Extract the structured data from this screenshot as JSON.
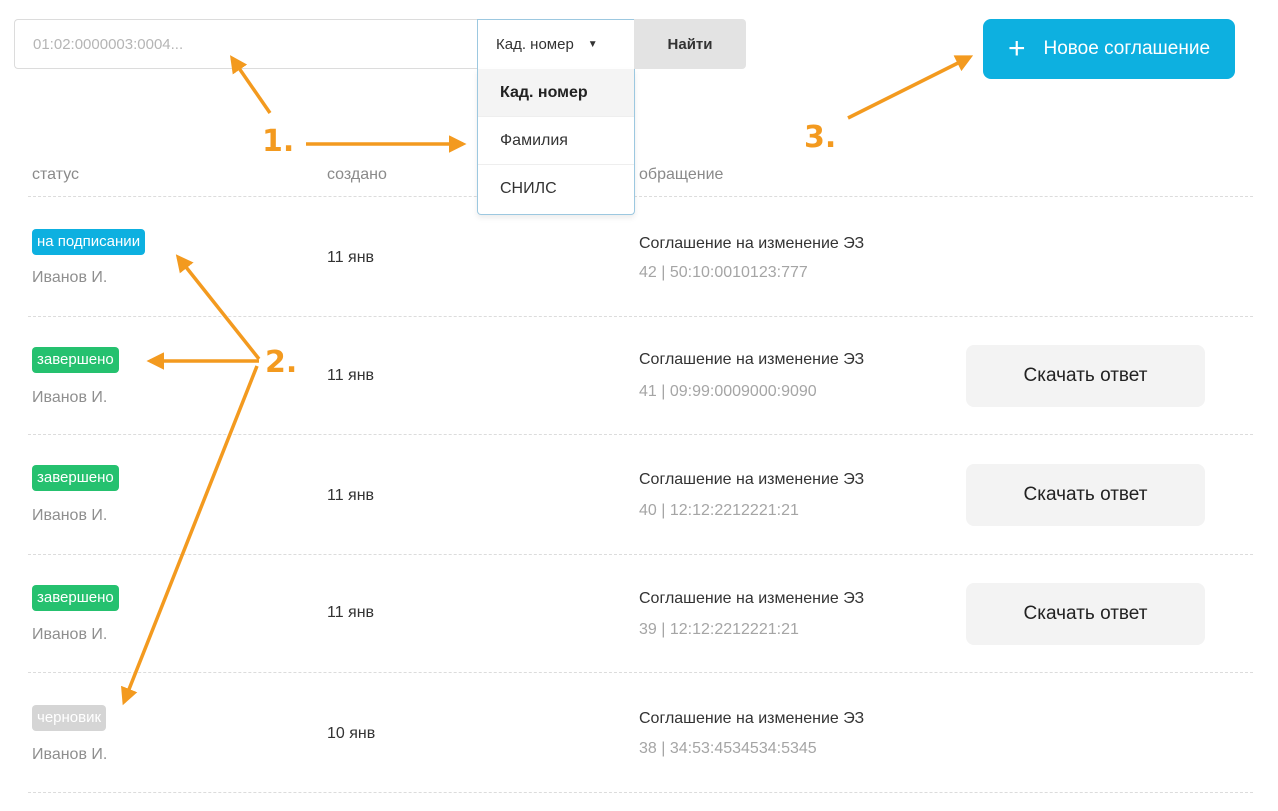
{
  "search": {
    "placeholder": "01:02:0000003:0004...",
    "type_selected": "Кад. номер",
    "find_label": "Найти",
    "dropdown_options": [
      "Кад. номер",
      "Фамилия",
      "СНИЛС"
    ]
  },
  "new_button": {
    "icon": "plus-icon",
    "label": "Новое соглашение"
  },
  "columns": [
    "статус",
    "создано",
    "обращение"
  ],
  "rows": [
    {
      "status": "на подписании",
      "status_color": "#0db0e0",
      "author": "Иванов И.",
      "created": "11 янв",
      "title": "Соглашение на изменение ЭЗ",
      "meta": "42 | 50:10:0010123:777",
      "download": ""
    },
    {
      "status": "завершено",
      "status_color": "#25c16f",
      "author": "Иванов И.",
      "created": "11 янв",
      "title": "Соглашение на изменение ЭЗ",
      "meta": "41 | 09:99:0009000:9090",
      "download": "Скачать ответ"
    },
    {
      "status": "завершено",
      "status_color": "#25c16f",
      "author": "Иванов И.",
      "created": "11 янв",
      "title": "Соглашение на изменение ЭЗ",
      "meta": "40 | 12:12:2212221:21",
      "download": "Скачать ответ"
    },
    {
      "status": "завершено",
      "status_color": "#25c16f",
      "author": "Иванов И.",
      "created": "11 янв",
      "title": "Соглашение на изменение ЭЗ",
      "meta": "39 | 12:12:2212221:21",
      "download": "Скачать ответ"
    },
    {
      "status": "черновик",
      "status_color": "#d5d5d5",
      "author": "Иванов И.",
      "created": "10 янв",
      "title": "Соглашение на изменение ЭЗ",
      "meta": "38 | 34:53:4534534:5345",
      "download": ""
    }
  ],
  "annotations": [
    "1.",
    "2.",
    "3."
  ],
  "accent_color": "#f39a1f"
}
